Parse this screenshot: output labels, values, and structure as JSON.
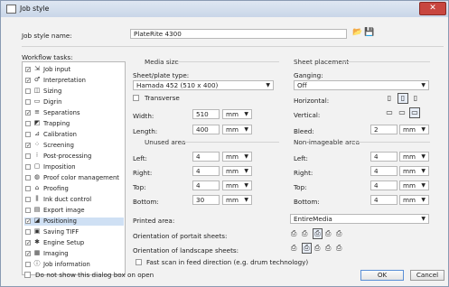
{
  "window": {
    "title": "Job style",
    "close_glyph": "✕"
  },
  "job_style": {
    "label": "Job style name:",
    "value": "PlateRite 4300",
    "open_icon": "folder-open-icon",
    "save_icon": "save-icon"
  },
  "workflow": {
    "label": "Workflow tasks:",
    "items": [
      {
        "label": "Job input",
        "checked": true,
        "icon": "input-icon",
        "glyph": "⇲",
        "selected": false
      },
      {
        "label": "Interpretation",
        "checked": true,
        "icon": "interpretation-icon",
        "glyph": "♂",
        "selected": false
      },
      {
        "label": "Sizing",
        "checked": false,
        "icon": "sizing-icon",
        "glyph": "◫",
        "selected": false
      },
      {
        "label": "Digrin",
        "checked": false,
        "icon": "digrin-icon",
        "glyph": "▭",
        "selected": false
      },
      {
        "label": "Separations",
        "checked": true,
        "icon": "separations-icon",
        "glyph": "≡",
        "selected": false
      },
      {
        "label": "Trapping",
        "checked": false,
        "icon": "trapping-icon",
        "glyph": "◩",
        "selected": false
      },
      {
        "label": "Calibration",
        "checked": false,
        "icon": "calibration-icon",
        "glyph": "⊿",
        "selected": false
      },
      {
        "label": "Screening",
        "checked": true,
        "icon": "screening-icon",
        "glyph": "⁘",
        "selected": false
      },
      {
        "label": "Post-processing",
        "checked": false,
        "icon": "post-processing-icon",
        "glyph": "⁝",
        "selected": false
      },
      {
        "label": "Imposition",
        "checked": false,
        "icon": "imposition-icon",
        "glyph": "▢",
        "selected": false
      },
      {
        "label": "Proof color management",
        "checked": false,
        "icon": "proof-color-icon",
        "glyph": "◍",
        "selected": false
      },
      {
        "label": "Proofing",
        "checked": false,
        "icon": "proofing-icon",
        "glyph": "⌂",
        "selected": false
      },
      {
        "label": "Ink duct control",
        "checked": false,
        "icon": "ink-duct-icon",
        "glyph": "⫼",
        "selected": false
      },
      {
        "label": "Export image",
        "checked": false,
        "icon": "export-icon",
        "glyph": "▤",
        "selected": false
      },
      {
        "label": "Positioning",
        "checked": true,
        "icon": "positioning-icon",
        "glyph": "◪",
        "selected": true
      },
      {
        "label": "Saving TIFF",
        "checked": false,
        "icon": "saving-tiff-icon",
        "glyph": "▣",
        "selected": false
      },
      {
        "label": "Engine Setup",
        "checked": true,
        "icon": "engine-setup-icon",
        "glyph": "✱",
        "selected": false
      },
      {
        "label": "Imaging",
        "checked": true,
        "icon": "imaging-icon",
        "glyph": "▦",
        "selected": false
      },
      {
        "label": "Job information",
        "checked": false,
        "icon": "info-icon",
        "glyph": "ⓘ",
        "selected": false
      }
    ]
  },
  "media": {
    "title": "Media size",
    "plate_type_label": "Sheet/plate type:",
    "plate_type_value": "Hamada 452 (510 x 400)",
    "transverse_label": "Transverse",
    "width_label": "Width:",
    "width_value": "510",
    "width_unit": "mm",
    "length_label": "Length:",
    "length_value": "400",
    "length_unit": "mm"
  },
  "unused": {
    "title": "Unused area",
    "left_label": "Left:",
    "left_value": "4",
    "left_unit": "mm",
    "right_label": "Right:",
    "right_value": "4",
    "right_unit": "mm",
    "top_label": "Top:",
    "top_value": "4",
    "top_unit": "mm",
    "bottom_label": "Bottom:",
    "bottom_value": "30",
    "bottom_unit": "mm"
  },
  "sheet": {
    "title": "Sheet placement",
    "ganging_label": "Ganging:",
    "ganging_value": "Off",
    "horizontal_label": "Horizontal:",
    "vertical_label": "Vertical:",
    "bleed_label": "Bleed:",
    "bleed_value": "2",
    "bleed_unit": "mm"
  },
  "nonimage": {
    "title": "Non-imageable area",
    "left_label": "Left:",
    "left_value": "4",
    "left_unit": "mm",
    "right_label": "Right:",
    "right_value": "4",
    "right_unit": "mm",
    "top_label": "Top:",
    "top_value": "4",
    "top_unit": "mm",
    "bottom_label": "Bottom:",
    "bottom_value": "4",
    "bottom_unit": "mm"
  },
  "printed": {
    "area_label": "Printed area:",
    "area_value": "EntireMedia",
    "portrait_label": "Orientation of portait sheets:",
    "landscape_label": "Orientation of landscape sheets:",
    "fast_scan_label": "Fast scan in feed direction (e.g. drum technology)"
  },
  "footer": {
    "dont_show_label": "Do not show this dialog box on open",
    "ok_label": "OK",
    "cancel_label": "Cancel"
  }
}
